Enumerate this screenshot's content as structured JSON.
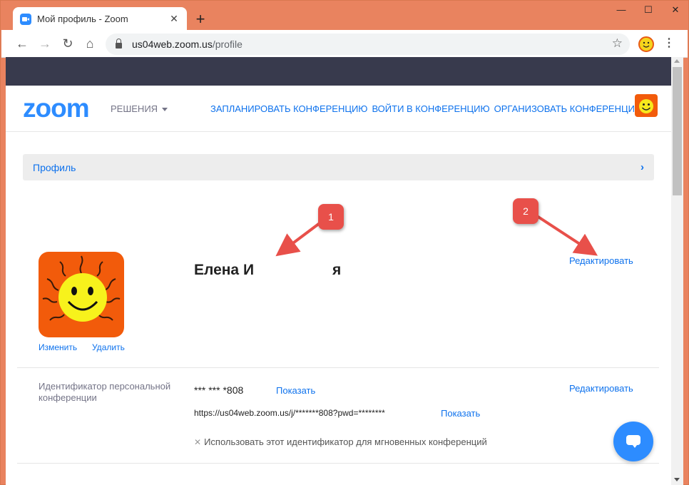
{
  "browser": {
    "tab_title": "Мой профиль - Zoom",
    "tab_close": "✕",
    "new_tab": "+",
    "window_controls": {
      "minimize": "—",
      "maximize": "☐",
      "close": "✕"
    },
    "url_host": "us04web.zoom.us",
    "url_path": "/profile",
    "nav": {
      "back": "←",
      "forward": "→",
      "reload": "↻",
      "home": "⌂"
    },
    "star": "☆",
    "menu": "⋮"
  },
  "header": {
    "logo": "zoom",
    "solutions": "РЕШЕНИЯ",
    "links": [
      "ЗАПЛАНИРОВАТЬ КОНФЕРЕНЦИЮ",
      "ВОЙТИ В КОНФЕРЕНЦИЮ",
      "ОРГАНИЗОВАТЬ КОНФЕРЕНЦИЮ"
    ]
  },
  "breadcrumb": {
    "label": "Профиль",
    "chevron": "›"
  },
  "profile": {
    "name_first": "Елена И",
    "name_last": "я",
    "change": "Изменить",
    "delete": "Удалить",
    "edit": "Редактировать"
  },
  "pmi": {
    "label": "Идентификатор персональной конференции",
    "masked": "*** *** *808",
    "show": "Показать",
    "url": "https://us04web.zoom.us/j/*******808?pwd=********",
    "show_url": "Показать",
    "use_instant": "Использовать этот идентификатор для мгновенных конференций",
    "use_mark": "✕",
    "edit": "Редактировать"
  },
  "callouts": [
    "1",
    "2"
  ],
  "colors": {
    "accent": "#0e72ed",
    "logo": "#2d8cff",
    "callout": "#e8504a",
    "frame": "#e9835f"
  }
}
